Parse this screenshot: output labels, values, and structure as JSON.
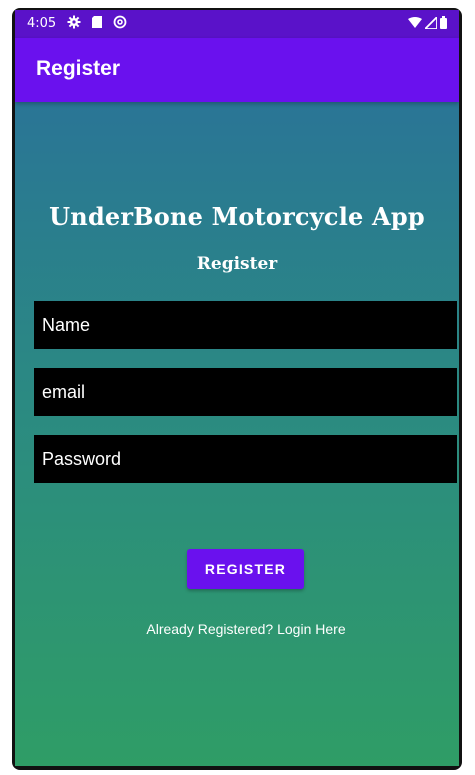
{
  "status_bar": {
    "time": "4:05",
    "left_icons": [
      "gear-icon",
      "sd-card-icon",
      "at-icon"
    ],
    "right_icons": [
      "wifi-icon",
      "signal-icon",
      "battery-icon"
    ],
    "color": "#5a12c9"
  },
  "app_bar": {
    "title": "Register",
    "color": "#6a11ee"
  },
  "main": {
    "app_title": "UnderBone Motorcycle App",
    "subtitle": "Register",
    "fields": {
      "name_placeholder": "Name",
      "email_placeholder": "email",
      "password_placeholder": "Password"
    },
    "register_button": "REGISTER",
    "login_link": "Already Registered? Login Here",
    "gradient_top": "#2a7596",
    "gradient_bottom": "#2f9d66"
  }
}
